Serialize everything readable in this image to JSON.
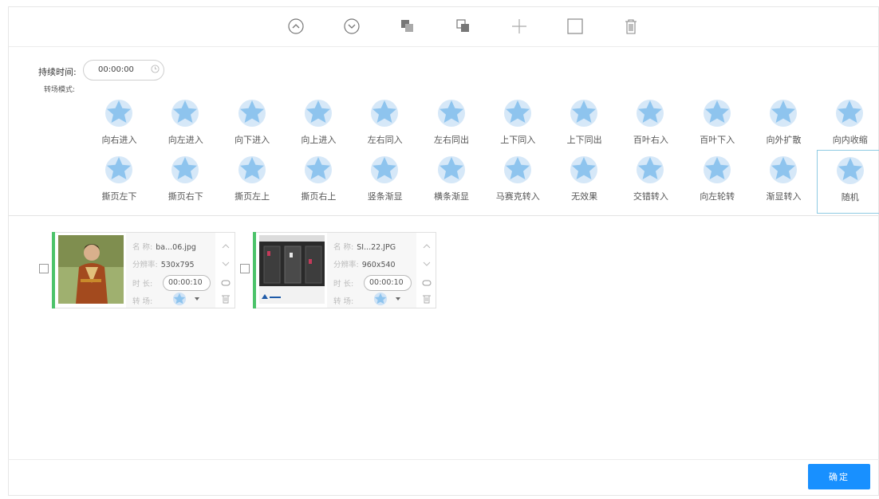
{
  "settings": {
    "duration_label": "持续时间:",
    "duration_value": "00:00:00",
    "mode_label": "转场模式:"
  },
  "effects_row1": [
    "向右进入",
    "向左进入",
    "向下进入",
    "向上进入",
    "左右同入",
    "左右同出",
    "上下同入",
    "上下同出",
    "百叶右入",
    "百叶下入",
    "向外扩散",
    "向内收缩"
  ],
  "effects_row2": [
    "撕页左下",
    "撕页右下",
    "撕页左上",
    "撕页右上",
    "竖条渐显",
    "横条渐显",
    "马赛克转入",
    "无效果",
    "交错转入",
    "向左轮转",
    "渐显转入",
    "随机"
  ],
  "selected_effect": "随机",
  "items": [
    {
      "name_label": "名 称:",
      "name": "ba...06.jpg",
      "res_label": "分辨率:",
      "resolution": "530x795",
      "dur_label": "时 长:",
      "duration": "00:00:10",
      "trans_label": "转 场:"
    },
    {
      "name_label": "名 称:",
      "name": "SI...22.JPG",
      "res_label": "分辨率:",
      "resolution": "960x540",
      "dur_label": "时 长:",
      "duration": "00:00:10",
      "trans_label": "转 场:"
    }
  ],
  "confirm_label": "确定",
  "colors": {
    "accent": "#1890ff",
    "star": "#8ec4ee",
    "bar": "#4cc36a"
  }
}
